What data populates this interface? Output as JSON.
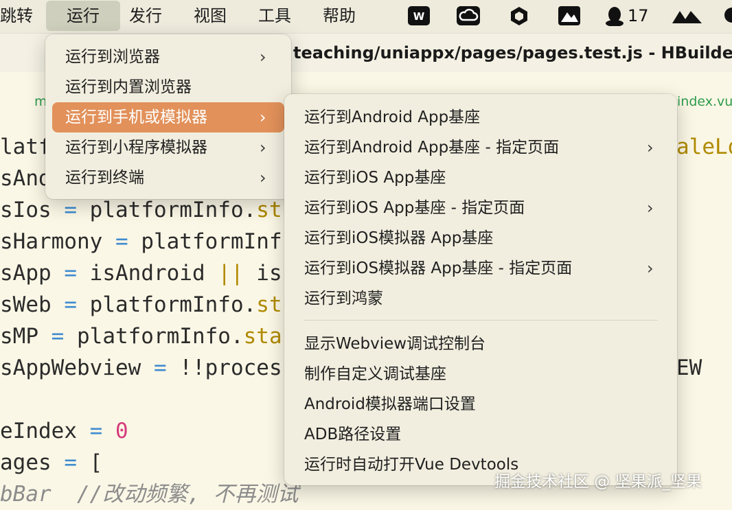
{
  "menubar": {
    "items": [
      "跳转",
      "运行",
      "发行",
      "视图",
      "工具",
      "帮助"
    ],
    "active": "运行",
    "status_count": "17"
  },
  "window": {
    "title": "teaching/uniappx/pages/pages.test.js - HBuilder X",
    "tab_left": "m",
    "tab_right": "index.vue"
  },
  "code": {
    "lines": [
      {
        "pre": "latf",
        "rest_right": "aleLo"
      },
      {
        "pre": "sAnd"
      },
      {
        "pre": "sIos ",
        "op": "=",
        "mid": " platformInfo.",
        "prop": "st"
      },
      {
        "pre": "sHarmony ",
        "op": "=",
        "mid": " platformInf"
      },
      {
        "pre": "sApp ",
        "op": "=",
        "mid": " isAndroid ",
        "op2": "||",
        "mid2": " is"
      },
      {
        "pre": "sWeb ",
        "op": "=",
        "mid": " platformInfo.",
        "prop": "st"
      },
      {
        "pre": "sMP ",
        "op": "=",
        "mid": " platformInfo.",
        "prop": "sta"
      },
      {
        "pre": "sAppWebview ",
        "op": "=",
        "mid": " !!proces",
        "rest_right": "EW"
      },
      {
        "pre": ""
      },
      {
        "pre": "eIndex ",
        "op": "=",
        "num": " 0"
      },
      {
        "pre": "ages ",
        "op": "=",
        "mid": " ["
      },
      {
        "pre": "bBar  ",
        "comment": "//改动频繁, 不再测试"
      }
    ]
  },
  "run_menu": {
    "items": [
      {
        "label": "运行到浏览器",
        "submenu": true
      },
      {
        "label": "运行到内置浏览器",
        "submenu": false
      },
      {
        "label": "运行到手机或模拟器",
        "submenu": true,
        "highlighted": true
      },
      {
        "label": "运行到小程序模拟器",
        "submenu": true
      },
      {
        "label": "运行到终端",
        "submenu": true
      }
    ]
  },
  "device_menu": {
    "group1": [
      {
        "label": "运行到Android App基座",
        "submenu": false
      },
      {
        "label": "运行到Android App基座 - 指定页面",
        "submenu": true
      },
      {
        "label": "运行到iOS App基座",
        "submenu": false
      },
      {
        "label": "运行到iOS App基座 - 指定页面",
        "submenu": true
      },
      {
        "label": "运行到iOS模拟器 App基座",
        "submenu": false
      },
      {
        "label": "运行到iOS模拟器 App基座 - 指定页面",
        "submenu": true
      },
      {
        "label": "运行到鸿蒙",
        "submenu": false
      }
    ],
    "group2": [
      {
        "label": "显示Webview调试控制台"
      },
      {
        "label": "制作自定义调试基座"
      },
      {
        "label": "Android模拟器端口设置"
      },
      {
        "label": "ADB路径设置"
      },
      {
        "label": "运行时自动打开Vue Devtools"
      }
    ]
  },
  "watermark": "掘金技术社区 @ 坚果派_坚果",
  "colors": {
    "highlight": "#e2915a",
    "menu_bg": "#f1eedf",
    "editor_bg": "#fbf7e6"
  }
}
